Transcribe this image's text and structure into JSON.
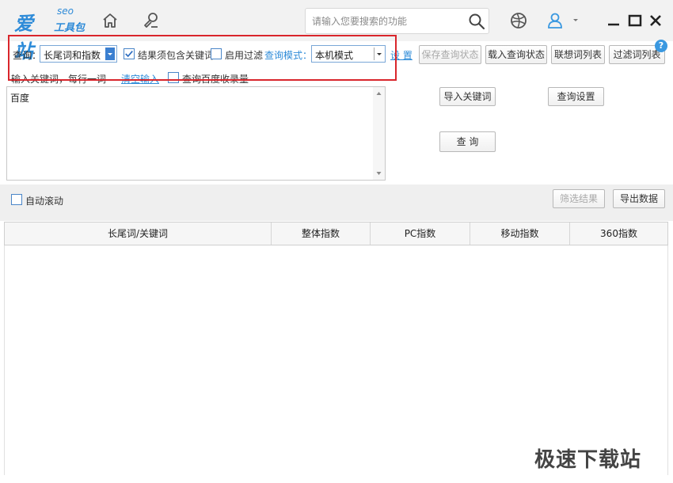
{
  "app": {
    "logo_main": "爱站",
    "logo_seo": "seo",
    "logo_sub": "工具包"
  },
  "header": {
    "search_placeholder": "请输入您要搜索的功能",
    "minimize": "—",
    "maximize": "☐",
    "close": "✕"
  },
  "query_bar": {
    "query_label": "查询：",
    "query_type": "长尾词和指数",
    "must_contain_label": "结果须包含关键词",
    "must_contain_checked": true,
    "enable_filter_label": "启用过滤",
    "enable_filter_checked": false,
    "mode_label": "查询模式：",
    "mode_value": "本机模式",
    "settings_link": "设 置"
  },
  "toolbar_buttons": {
    "save_state": "保存查询状态",
    "load_state": "载入查询状态",
    "assoc_list": "联想词列表",
    "filter_list": "过滤词列表"
  },
  "help_icon": "?",
  "input_row": {
    "instruction": "输入关键词，每行一词",
    "clear_link": "清空输入",
    "baidu_index_label": "查询百度收录量",
    "baidu_index_checked": false
  },
  "keywords": {
    "value": "百度"
  },
  "side_buttons": {
    "import": "导入关键词",
    "settings": "查询设置",
    "query": "查 询"
  },
  "bottom_bar": {
    "auto_scroll_label": "自动滚动",
    "filter_results": "筛选结果",
    "export": "导出数据"
  },
  "table": {
    "columns": [
      "长尾词/关键词",
      "整体指数",
      "PC指数",
      "移动指数",
      "360指数"
    ],
    "rows": []
  },
  "watermark": "极速下载站",
  "colors": {
    "brand_blue": "#2e8bd8",
    "highlight_red": "#d9262c"
  }
}
